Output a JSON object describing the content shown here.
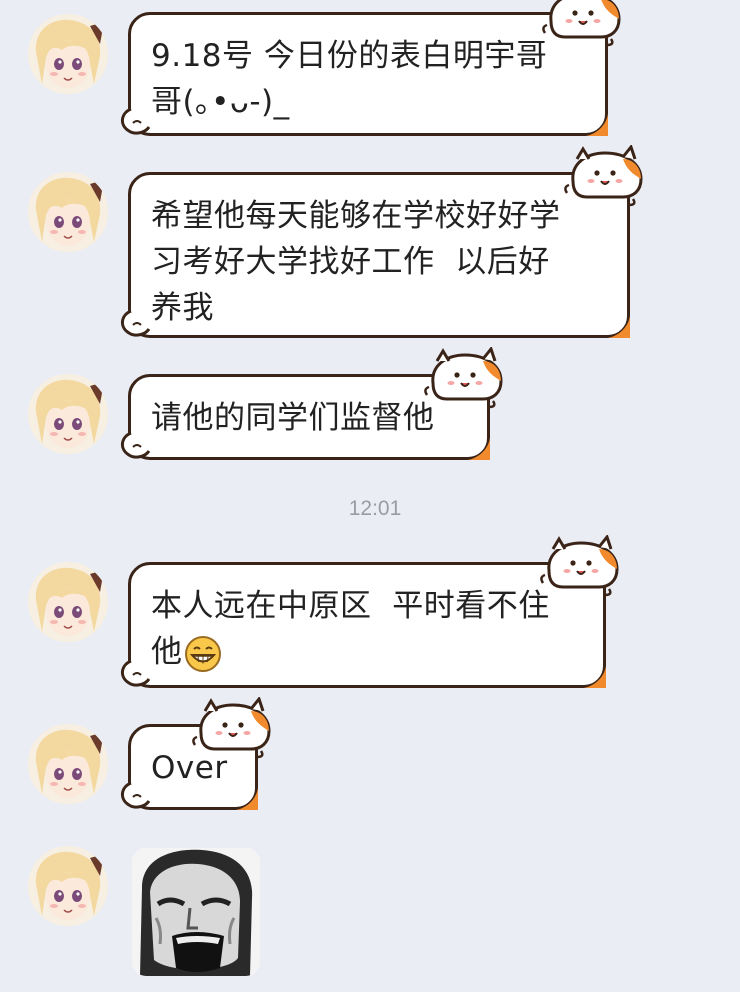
{
  "messages": [
    {
      "id": "m1",
      "text": "9.18号 今日份的表白明宇哥\n哥(｡•ᴗ-)_"
    },
    {
      "id": "m2",
      "text": "希望他每天能够在学校好好学\n习考好大学找好工作  以后好\n养我"
    },
    {
      "id": "m3",
      "text": "请他的同学们监督他"
    },
    {
      "id": "m4",
      "text_line1": "本人远在中原区  平时看不住",
      "text_line2": "他",
      "emoji": "grinning-face-icon"
    },
    {
      "id": "m5",
      "text": "Over"
    }
  ],
  "timestamp": "12:01",
  "sticker": {
    "icon": "meme-face-icon"
  },
  "colors": {
    "background": "#ebedf4",
    "bubble_border": "#3a2418",
    "bubble_fill": "#ffffff",
    "text": "#222222",
    "deco_orange": "#f08a2c",
    "timestamp": "#9a9ca4"
  }
}
